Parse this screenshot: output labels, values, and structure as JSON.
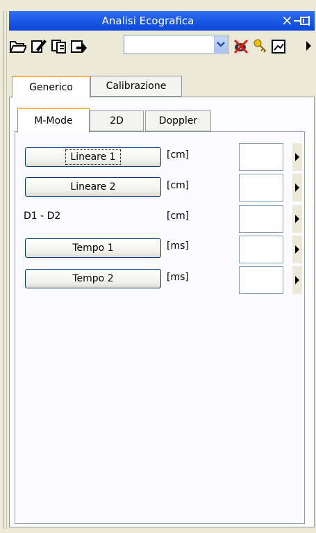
{
  "window": {
    "title": "Analisi Ecografica"
  },
  "toolbar": {
    "icons": [
      "open-folder-icon",
      "edit-icon",
      "copy-icon",
      "export-icon"
    ],
    "right_icons": [
      "no-view-icon",
      "key-icon",
      "chart-icon",
      "more-icon"
    ],
    "combo_value": ""
  },
  "tabs": {
    "items": [
      "Generico",
      "Calibrazione"
    ],
    "active": "Generico"
  },
  "subtabs": {
    "items": [
      "M-Mode",
      "2D",
      "Doppler"
    ],
    "active": "M-Mode"
  },
  "measurements": [
    {
      "label": "Lineare 1",
      "unit": "[cm]",
      "type": "button",
      "value": ""
    },
    {
      "label": "Lineare 2",
      "unit": "[cm]",
      "type": "button",
      "value": ""
    },
    {
      "label": "D1 - D2",
      "unit": "[cm]",
      "type": "label",
      "value": ""
    },
    {
      "label": "Tempo 1",
      "unit": "[ms]",
      "type": "button",
      "value": ""
    },
    {
      "label": "Tempo 2",
      "unit": "[ms]",
      "type": "button",
      "value": ""
    }
  ],
  "colors": {
    "title_bar": "#0a46d8",
    "tab_accent": "#f8b24a",
    "button_border": "#003c74"
  }
}
